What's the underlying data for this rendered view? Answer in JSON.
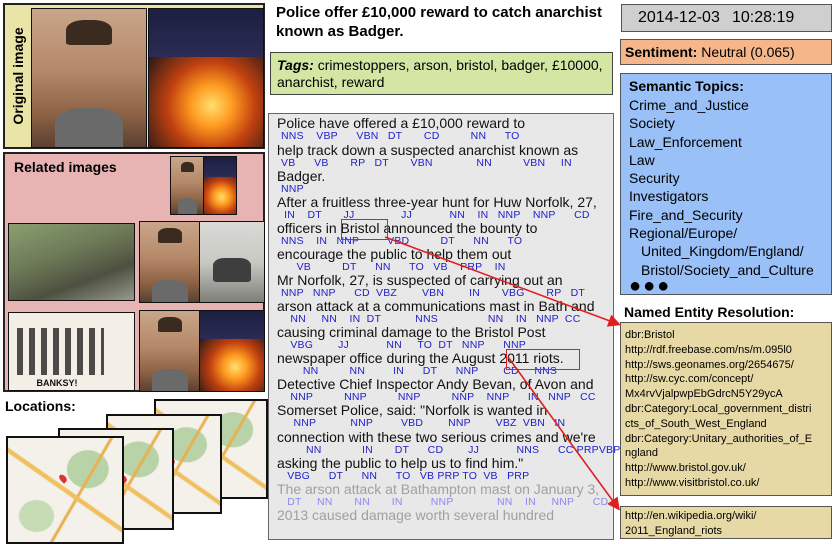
{
  "original_image": {
    "label": "Original image"
  },
  "related": {
    "title": "Related images"
  },
  "locations": {
    "title": "Locations:"
  },
  "headline": "Police offer £10,000 reward to catch anarchist known as Badger.",
  "tags": {
    "label": "Tags:",
    "text": " crimestoppers, arson, bristol, badger, £10000, anarchist, reward"
  },
  "date": "2014-12-03",
  "time": "10:28:19",
  "sentiment": {
    "label": "Sentiment:",
    "value": " Neutral (0.065)"
  },
  "topics": {
    "title": "Semantic Topics:",
    "items": [
      "Crime_and_Justice",
      "Society",
      "Law_Enforcement",
      "Law",
      "Security",
      "Investigators",
      "Fire_and_Security",
      "Regional/Europe/",
      "United_Kingdom/England/",
      "Bristol/Society_and_Culture"
    ],
    "more": "●●●"
  },
  "ner": {
    "title": "Named Entity Resolution:",
    "lines": [
      "dbr:Bristol",
      "http://rdf.freebase.com/ns/m.095l0",
      "http://sws.geonames.org/2654675/",
      "http://sw.cyc.com/concept/",
      "Mx4rvVjalpwpEbGdrcN5Y29ycA",
      "dbr:Category:Local_government_distri",
      "cts_of_South_West_England",
      "dbr:Category:Unitary_authorities_of_E",
      "ngland",
      "http://www.bristol.gov.uk/",
      "http://www.visitbristol.co.uk/"
    ],
    "wiki_lines": [
      "http://en.wikipedia.org/wiki/",
      "2011_England_riots"
    ]
  },
  "article": {
    "lines": [
      {
        "text": "Police have offered a £10,000 reward to",
        "pos": "NNS    VBP      VBN   DT       CD          NN      TO"
      },
      {
        "text": "help track down a suspected anarchist known as",
        "pos": "VB      VB       RP   DT       VBN              NN          VBN     IN"
      },
      {
        "text": "Badger.",
        "pos": "NNP"
      },
      {
        "text": "After a fruitless three-year hunt for Huw Norfolk, 27,",
        "pos": " IN    DT       JJ               JJ            NN    IN   NNP    NNP      CD"
      },
      {
        "text": "officers in Bristol announced the bounty to",
        "pos": "NNS    IN   NNP         VBD          DT      NN      TO"
      },
      {
        "text": "encourage the public to help them out",
        "pos": "     VB          DT      NN      TO   VB    PRP    IN"
      },
      {
        "text": "Mr Norfolk, 27, is suspected of carrying out an",
        "pos": "NNP   NNP      CD  VBZ        VBN        IN       VBG       RP   DT"
      },
      {
        "text": "arson attack at a communications mast in Bath and",
        "pos": "   NN     NN    IN  DT           NNS                NN    IN   NNP  CC"
      },
      {
        "text": "causing criminal damage to the Bristol Post",
        "pos": "   VBG        JJ            NN     TO  DT   NNP      NNP"
      },
      {
        "text": "newspaper office during the August 2011 riots.",
        "pos": "       NN          NN         IN      DT      NNP        CD     NNS"
      },
      {
        "text": "Detective Chief Inspector Andy Bevan, of Avon and",
        "pos": "   NNP          NNP          NNP          NNP    NNP      IN   NNP   CC"
      },
      {
        "text": "Somerset Police, said: \"Norfolk is wanted in",
        "pos": "    NNP           NNP         VBD        NNP        VBZ  VBN   IN"
      },
      {
        "text": "connection with these two serious crimes and we're",
        "pos": "        NN             IN       DT      CD        JJ            NNS      CC PRPVBP"
      },
      {
        "text": "asking the public to help us to find him.\"",
        "pos": "  VBG      DT      NN      TO   VB PRP TO  VB   PRP"
      },
      {
        "text": "The arson attack at Bathampton mast on January 3,",
        "pos": "  DT     NN       NN       IN         NNP              NN    IN     NNP      CD"
      },
      {
        "text": "2013 caused damage worth several hundred",
        "pos": ""
      }
    ]
  }
}
